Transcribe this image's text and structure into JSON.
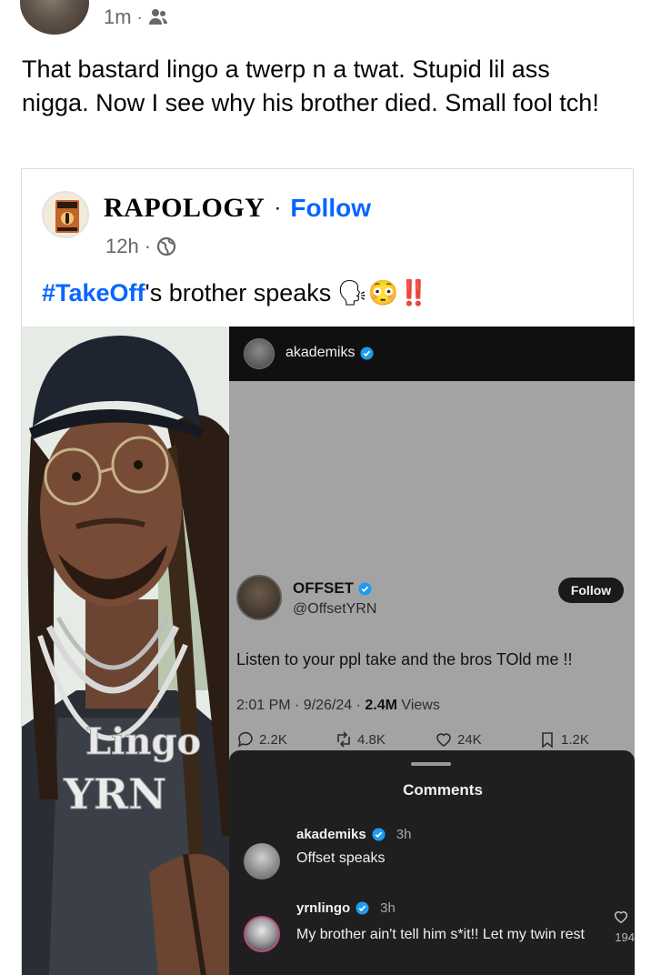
{
  "post": {
    "time": "1m",
    "dot": "·",
    "privacy_icon": "friends-icon",
    "text": "That bastard lingo a twerp n a twat. Stupid lil ass nigga. Now I see why his brother died. Small fool tch!"
  },
  "shared": {
    "page_name": "RAPOLOGY",
    "separator": "·",
    "follow_label": "Follow",
    "time": "12h",
    "dot": "·",
    "privacy_icon": "globe-icon",
    "hashtag": "#TakeOff",
    "caption_rest": "'s brother speaks",
    "emojis": "🗣😳‼️",
    "logo_text": "RAPOLOGY"
  },
  "photo": {
    "chain_text_1": "Lingo",
    "chain_text_2": "YRN"
  },
  "instagram": {
    "username": "akademiks"
  },
  "tweet": {
    "name": "OFFSET",
    "handle": "@OffsetYRN",
    "follow_label": "Follow",
    "text": "Listen to your ppl take and the bros TOld me !!",
    "date": "2:01 PM · 9/26/24 · ",
    "views_count": "2.4M",
    "views_label": " Views",
    "replies": "2.2K",
    "retweets": "4.8K",
    "likes": "24K",
    "bookmarks": "1.2K"
  },
  "comments": {
    "title": "Comments",
    "items": [
      {
        "user": "akademiks",
        "time": "3h",
        "text": "Offset speaks"
      },
      {
        "user": "yrnlingo",
        "time": "3h",
        "text": "My brother ain't tell him s*it!! Let my twin rest",
        "likes": "194"
      }
    ]
  },
  "colors": {
    "link_blue": "#0866ff",
    "meta_gray": "#65676b",
    "verified_blue": "#1d9bf0"
  }
}
